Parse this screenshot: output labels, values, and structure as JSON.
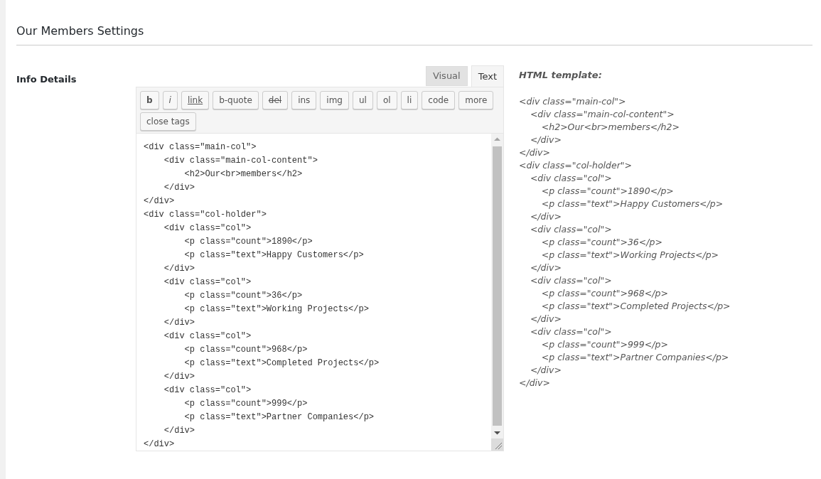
{
  "section_title": "Our Members Settings",
  "field_label": "Info Details",
  "editor": {
    "tabs": [
      {
        "label": "Visual",
        "selected": false
      },
      {
        "label": "Text",
        "selected": true
      }
    ],
    "toolbar": [
      {
        "label": "b",
        "kind": "bold"
      },
      {
        "label": "i",
        "kind": "italic"
      },
      {
        "label": "link",
        "kind": "underline"
      },
      {
        "label": "b-quote",
        "kind": "plain"
      },
      {
        "label": "del",
        "kind": "strike"
      },
      {
        "label": "ins",
        "kind": "plain"
      },
      {
        "label": "img",
        "kind": "plain"
      },
      {
        "label": "ul",
        "kind": "plain"
      },
      {
        "label": "ol",
        "kind": "plain"
      },
      {
        "label": "li",
        "kind": "plain"
      },
      {
        "label": "code",
        "kind": "plain"
      },
      {
        "label": "more",
        "kind": "plain"
      },
      {
        "label": "close tags",
        "kind": "plain"
      }
    ],
    "content": "<div class=\"main-col\">\n    <div class=\"main-col-content\">\n        <h2>Our<br>members</h2>\n    </div>\n</div>\n<div class=\"col-holder\">\n    <div class=\"col\">\n        <p class=\"count\">1890</p>\n        <p class=\"text\">Happy Customers</p>\n    </div>\n    <div class=\"col\">\n        <p class=\"count\">36</p>\n        <p class=\"text\">Working Projects</p>\n    </div>\n    <div class=\"col\">\n        <p class=\"count\">968</p>\n        <p class=\"text\">Completed Projects</p>\n    </div>\n    <div class=\"col\">\n        <p class=\"count\">999</p>\n        <p class=\"text\">Partner Companies</p>\n    </div>\n</div>"
  },
  "template": {
    "title": "HTML template:",
    "code": "<div class=\"main-col\">\n    <div class=\"main-col-content\">\n        <h2>Our<br>members</h2>\n    </div>\n</div>\n<div class=\"col-holder\">\n    <div class=\"col\">\n        <p class=\"count\">1890</p>\n        <p class=\"text\">Happy Customers</p>\n    </div>\n    <div class=\"col\">\n        <p class=\"count\">36</p>\n        <p class=\"text\">Working Projects</p>\n    </div>\n    <div class=\"col\">\n        <p class=\"count\">968</p>\n        <p class=\"text\">Completed Projects</p>\n    </div>\n    <div class=\"col\">\n        <p class=\"count\">999</p>\n        <p class=\"text\">Partner Companies</p>\n    </div>\n</div>"
  }
}
